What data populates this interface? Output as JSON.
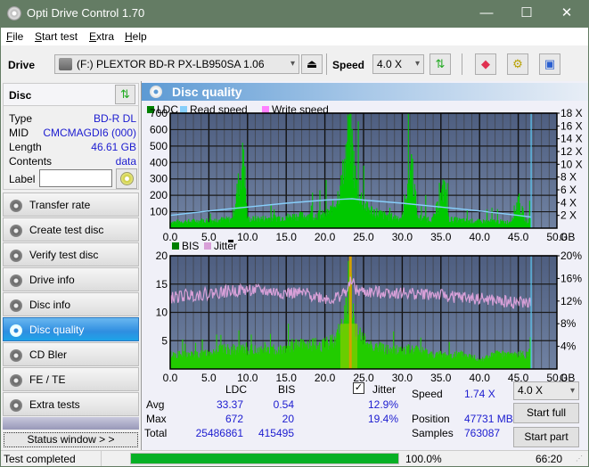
{
  "window": {
    "title": "Opti Drive Control 1.70",
    "minimize": "—",
    "maximize": "☐",
    "close": "✕"
  },
  "menu": [
    {
      "label": "File",
      "key": "F",
      "rest": "ile"
    },
    {
      "label": "Start test",
      "key": "S",
      "rest": "tart test"
    },
    {
      "label": "Extra",
      "key": "E",
      "rest": "xtra"
    },
    {
      "label": "Help",
      "key": "H",
      "rest": "elp"
    }
  ],
  "toolbar": {
    "drive_label": "Drive",
    "drive_value": "(F:)  PLEXTOR BD-R  PX-LB950SA 1.06",
    "speed_label": "Speed",
    "speed_value": "4.0 X",
    "eject_icon": "eject-icon",
    "refresh_icon": "refresh-icon",
    "erase_icon": "eraser-icon",
    "settings_icon": "gears-icon",
    "save_icon": "save-icon"
  },
  "disc": {
    "header": "Disc",
    "rows": [
      {
        "key": "Type",
        "value": "BD-R DL"
      },
      {
        "key": "MID",
        "value": "CMCMAGDI6 (000)"
      },
      {
        "key": "Length",
        "value": "46.61 GB"
      },
      {
        "key": "Contents",
        "value": "data"
      }
    ],
    "label_key": "Label",
    "label_value": ""
  },
  "nav": [
    {
      "label": "Transfer rate",
      "active": false
    },
    {
      "label": "Create test disc",
      "active": false
    },
    {
      "label": "Verify test disc",
      "active": false
    },
    {
      "label": "Drive info",
      "active": false
    },
    {
      "label": "Disc info",
      "active": false
    },
    {
      "label": "Disc quality",
      "active": true
    },
    {
      "label": "CD Bler",
      "active": false
    },
    {
      "label": "FE / TE",
      "active": false
    },
    {
      "label": "Extra tests",
      "active": false
    }
  ],
  "status_window_btn": "Status window > >",
  "panel": {
    "title": "Disc quality"
  },
  "chart_data": [
    {
      "type": "bar",
      "title": "LDC / Read speed",
      "legend": [
        {
          "name": "LDC",
          "color": "#008000"
        },
        {
          "name": "Read speed",
          "color": "#87cefa"
        },
        {
          "name": "Write speed",
          "color": "#ff80ff"
        }
      ],
      "legend_position": "top-left",
      "xlabel": "GB",
      "x_ticks": [
        "0.0",
        "5.0",
        "10.0",
        "15.0",
        "20.0",
        "25.0",
        "30.0",
        "35.0",
        "40.0",
        "45.0",
        "50.0"
      ],
      "xlim": [
        0,
        50
      ],
      "ylim_left": [
        0,
        700
      ],
      "y_ticks_left": [
        "100",
        "200",
        "300",
        "400",
        "500",
        "600",
        "700"
      ],
      "ylim_right": [
        0,
        18
      ],
      "y_ticks_right": [
        "2 X",
        "4 X",
        "6 X",
        "8 X",
        "10 X",
        "12 X",
        "14 X",
        "16 X",
        "18 X"
      ],
      "grid": true,
      "end_marker_gb": 46.61,
      "ldc_series": {
        "name": "LDC",
        "x": [
          0,
          2,
          4,
          6,
          8,
          9.5,
          10,
          12,
          14,
          15,
          16,
          18,
          20,
          21,
          22,
          22.5,
          23,
          23.2,
          23.5,
          24,
          25,
          26,
          28,
          30,
          31.2,
          32,
          34,
          35.5,
          36,
          38,
          40,
          42,
          44,
          45,
          46,
          46.6
        ],
        "y": [
          40,
          45,
          50,
          55,
          60,
          480,
          60,
          65,
          70,
          75,
          80,
          85,
          90,
          130,
          260,
          400,
          600,
          672,
          560,
          300,
          160,
          120,
          80,
          70,
          450,
          70,
          60,
          280,
          60,
          50,
          45,
          45,
          40,
          190,
          40,
          60
        ]
      },
      "read_speed_series": {
        "name": "Read speed",
        "x": [
          0,
          5,
          10,
          15,
          20,
          23.5,
          25,
          30,
          35,
          40,
          45,
          46.6
        ],
        "y": [
          2.0,
          2.7,
          3.3,
          3.9,
          4.4,
          4.6,
          4.4,
          3.9,
          3.3,
          2.7,
          2.0,
          1.74
        ]
      }
    },
    {
      "type": "bar",
      "title": "BIS / Jitter",
      "legend": [
        {
          "name": "BIS",
          "color": "#008000"
        },
        {
          "name": "Jitter",
          "color": "#d8a0d8"
        }
      ],
      "legend_position": "top-left",
      "xlabel": "GB",
      "x_ticks": [
        "0.0",
        "5.0",
        "10.0",
        "15.0",
        "20.0",
        "25.0",
        "30.0",
        "35.0",
        "40.0",
        "45.0",
        "50.0"
      ],
      "xlim": [
        0,
        50
      ],
      "ylim_left": [
        0,
        20
      ],
      "y_ticks_left": [
        "5",
        "10",
        "15",
        "20"
      ],
      "ylim_right": [
        0,
        20
      ],
      "y_ticks_right": [
        "4%",
        "8%",
        "12%",
        "16%",
        "20%"
      ],
      "grid": true,
      "end_marker_gb": 46.61,
      "bis_series": {
        "name": "BIS",
        "x": [
          0,
          2,
          4,
          6,
          8,
          10,
          12,
          14,
          16,
          18,
          20,
          21,
          22,
          22.5,
          23,
          23.3,
          23.6,
          24,
          25,
          26,
          28,
          30,
          32,
          34,
          36,
          38,
          40,
          42,
          44,
          46,
          46.6
        ],
        "y": [
          3,
          3,
          3,
          4,
          4,
          4,
          4,
          4,
          5,
          5,
          5,
          6,
          8,
          11,
          14,
          20,
          12,
          8,
          6,
          5,
          4,
          4,
          4,
          3,
          3,
          3,
          2,
          3,
          3,
          3,
          4
        ]
      },
      "jitter_series": {
        "name": "Jitter",
        "x": [
          0,
          2,
          4,
          6,
          8,
          10,
          12,
          14,
          16,
          18,
          20,
          21,
          22,
          23,
          23.5,
          24,
          26,
          28,
          30,
          32,
          34,
          36,
          38,
          40,
          42,
          44,
          46,
          46.6
        ],
        "y": [
          12.5,
          13.0,
          13.2,
          13.5,
          13.8,
          14.0,
          13.8,
          13.5,
          13.4,
          13.2,
          12.5,
          12.3,
          13.0,
          14.0,
          16.0,
          13.8,
          13.5,
          13.6,
          13.4,
          13.3,
          13.2,
          12.8,
          12.6,
          12.4,
          12.0,
          11.8,
          11.7,
          11.9
        ]
      }
    }
  ],
  "stats": {
    "col_ldc": "LDC",
    "col_bis": "BIS",
    "rows": [
      {
        "label": "Avg",
        "ldc": "33.37",
        "bis": "0.54",
        "jitter": "12.9%"
      },
      {
        "label": "Max",
        "ldc": "672",
        "bis": "20",
        "jitter": "19.4%"
      },
      {
        "label": "Total",
        "ldc": "25486861",
        "bis": "415495",
        "jitter": ""
      }
    ],
    "jitter_label": "Jitter",
    "jitter_checked": true,
    "speed_label": "Speed",
    "speed_value": "1.74 X",
    "position_label": "Position",
    "position_value": "47731 MB",
    "samples_label": "Samples",
    "samples_value": "763087",
    "speed_select": "4.0 X",
    "start_full": "Start full",
    "start_part": "Start part"
  },
  "statusbar": {
    "text": "Test completed",
    "progress": 100.0,
    "progress_text": "100.0%",
    "time": "66:20"
  },
  "colors": {
    "titlebar": "#647c64",
    "plot_bg_top": "#4e5e80",
    "plot_bg_bottom": "#7082a2",
    "ldc": "#00c800",
    "read_speed": "#87cefa",
    "jitter": "#d8a0d8",
    "value_text": "#1c1cd0",
    "progress": "#06b025"
  }
}
